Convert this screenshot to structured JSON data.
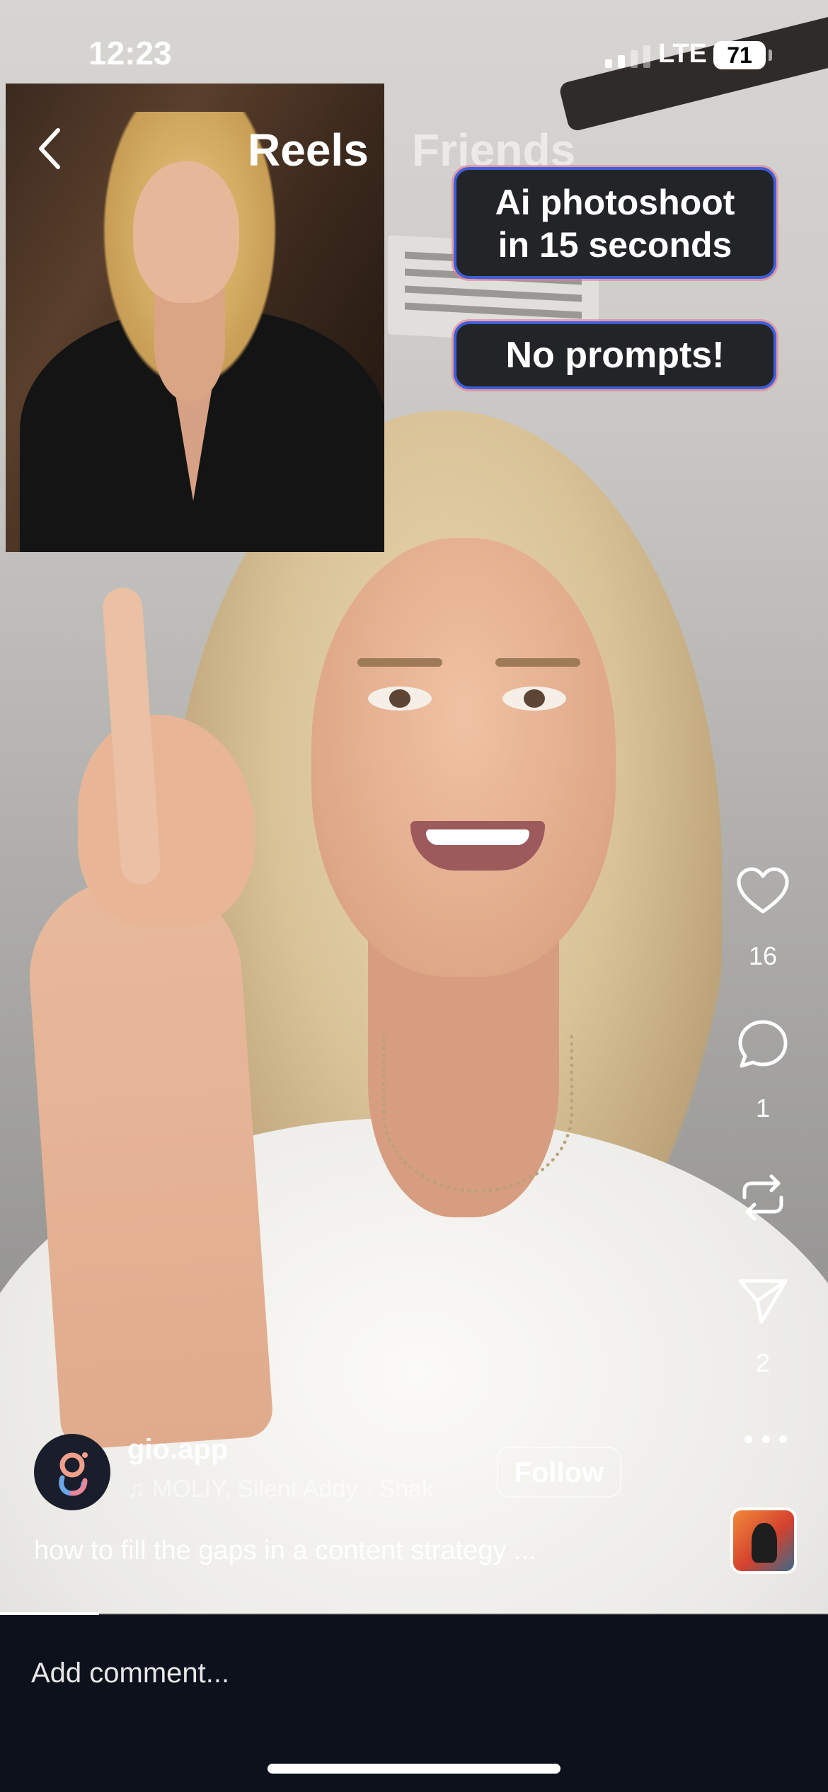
{
  "status_bar": {
    "time": "12:23",
    "network": "LTE",
    "battery": "71"
  },
  "header": {
    "tabs": [
      {
        "label": "Reels",
        "active": true
      },
      {
        "label": "Friends",
        "active": false
      }
    ]
  },
  "overlays": {
    "caption_1_line_1": "Ai photoshoot",
    "caption_1_line_2": "in 15 seconds",
    "caption_2": "No prompts!"
  },
  "actions": {
    "likes": "16",
    "comments": "1",
    "shares": "2"
  },
  "post": {
    "username": "gio.app",
    "audio": "♫ MOLIY, Silent Addy · Shak",
    "follow_label": "Follow",
    "description": "how to fill the gaps in a content strategy ..."
  },
  "video_progress": 0.12,
  "comment_bar": {
    "placeholder": "Add comment..."
  },
  "colors": {
    "caption_border": "#3f5ed8",
    "caption_bg": "#232427",
    "comment_bar_bg": "#0c111b"
  },
  "icons": [
    "back-icon",
    "heart-icon",
    "comment-icon",
    "repost-icon",
    "send-icon",
    "more-icon",
    "signal-icon",
    "battery-icon"
  ]
}
